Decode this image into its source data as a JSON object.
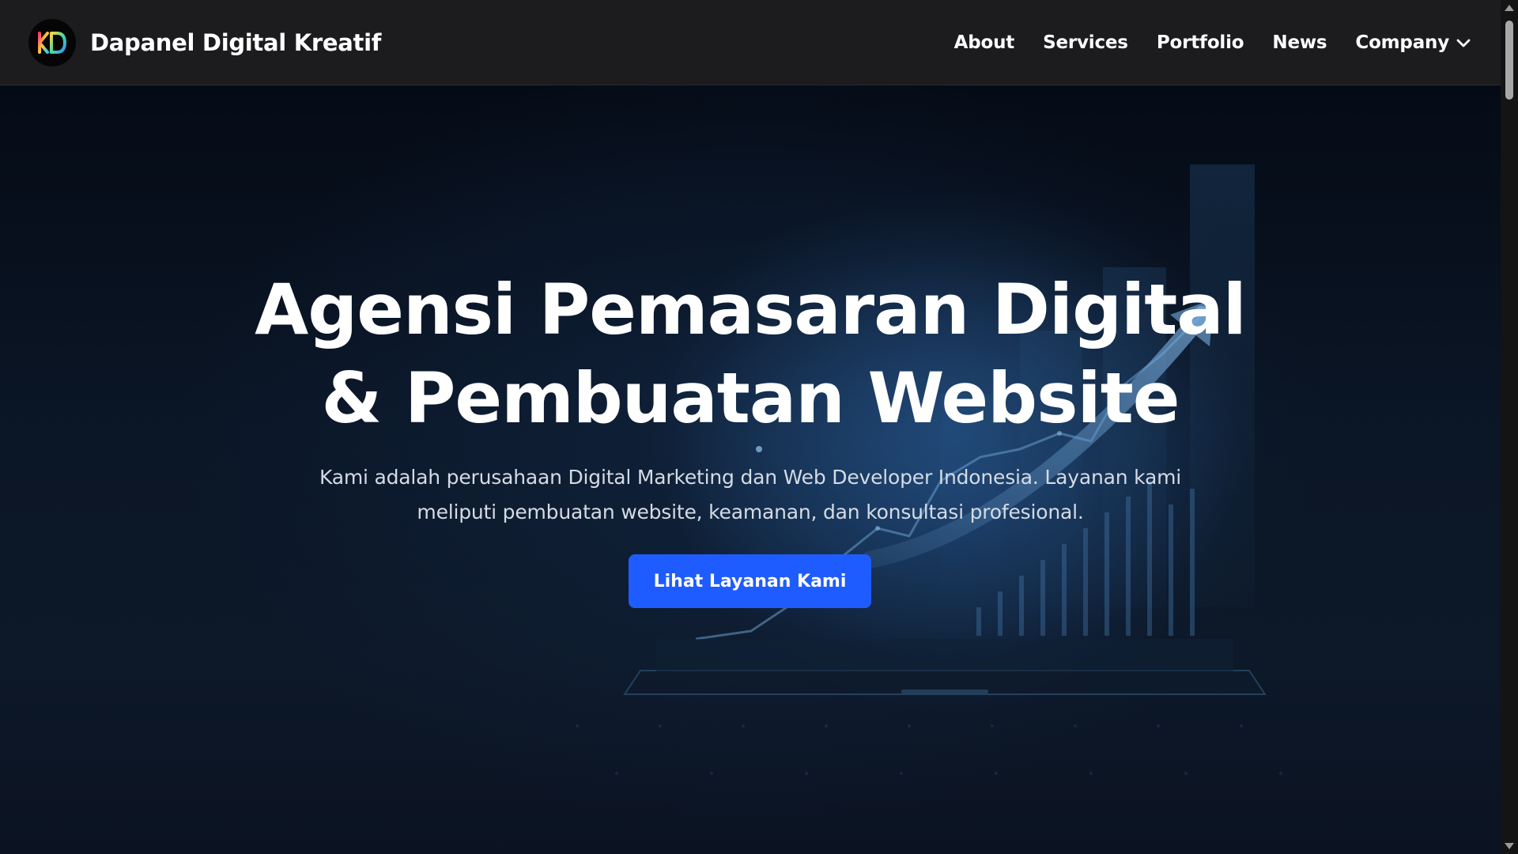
{
  "navbar": {
    "brand_name": "Dapanel Digital Kreatif",
    "logo_icon": "kd-logo-icon",
    "links": [
      {
        "label": "About"
      },
      {
        "label": "Services"
      },
      {
        "label": "Portfolio"
      },
      {
        "label": "News"
      },
      {
        "label": "Company",
        "icon": "chevron-down-icon"
      }
    ]
  },
  "hero": {
    "title_line1": "Agensi Pemasaran Digital",
    "title_line2": "& Pembuatan Website",
    "subtitle": "Kami adalah perusahaan Digital Marketing dan Web Developer Indonesia. Layanan kami meliputi pembuatan website, keamanan, dan konsultasi profesional.",
    "cta_label": "Lihat Layanan Kami",
    "background_icon": "growth-chart-laptop-icon"
  },
  "colors": {
    "navbar_bg": "#1c1c1e",
    "hero_bg": "#0b1626",
    "accent": "#1f5cff",
    "text": "#ffffff"
  }
}
